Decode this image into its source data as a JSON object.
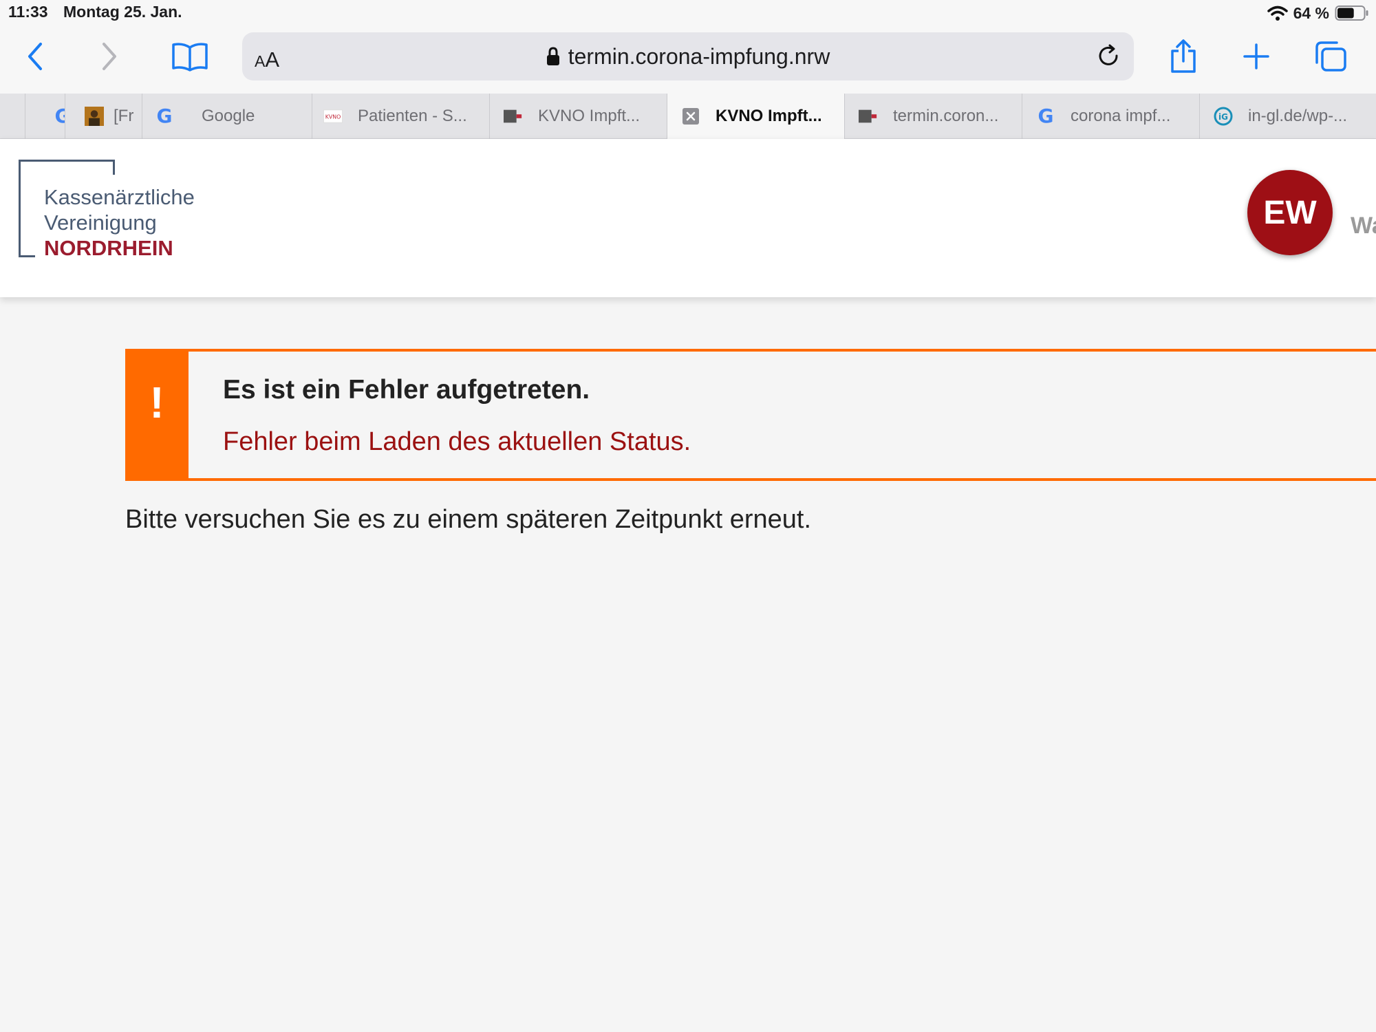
{
  "status_bar": {
    "time": "11:33",
    "date": "Montag 25. Jan.",
    "battery": "64 %",
    "battery_fill_fraction": 0.64
  },
  "toolbar": {
    "back_icon": "chevron-left-icon",
    "forward_icon": "chevron-right-icon",
    "bookmarks_icon": "book-icon",
    "text_size_small": "A",
    "text_size_large": "A",
    "url": "termin.corona-impfung.nrw",
    "share_icon": "share-icon",
    "new_tab_icon": "plus-icon",
    "tabs_overview_icon": "tabs-icon",
    "accent_color": "#1a7cf2"
  },
  "tabs": [
    {
      "label": "",
      "favicon": "google-g"
    },
    {
      "label": "[Fr",
      "favicon": "image-thumb"
    },
    {
      "label": "Google",
      "favicon": "google-g"
    },
    {
      "label": "Patienten - S...",
      "favicon": "kvno"
    },
    {
      "label": "KVNO Impft...",
      "favicon": "kvno-square"
    },
    {
      "label": "KVNO Impft...",
      "favicon": "close-x",
      "active": true
    },
    {
      "label": "termin.coron...",
      "favicon": "kvno-square"
    },
    {
      "label": "corona impf...",
      "favicon": "google-g"
    },
    {
      "label": "in-gl.de/wp-...",
      "favicon": "globe"
    }
  ],
  "header": {
    "logo_line1": "Kassenärztliche",
    "logo_line2": "Vereinigung",
    "logo_line3": "NORDRHEIN",
    "avatar_initials": "EW",
    "user_name_partial": "Wa",
    "brand_red": "#9b1c2e",
    "avatar_color": "#9e0f15"
  },
  "alert": {
    "icon": "!",
    "title": "Es ist ein Fehler aufgetreten.",
    "message": "Fehler beim Laden des aktuellen Status.",
    "accent_color": "#ff6a00",
    "message_color": "#9b1111"
  },
  "body_text": "Bitte versuchen Sie es zu einem späteren Zeitpunkt erneut."
}
